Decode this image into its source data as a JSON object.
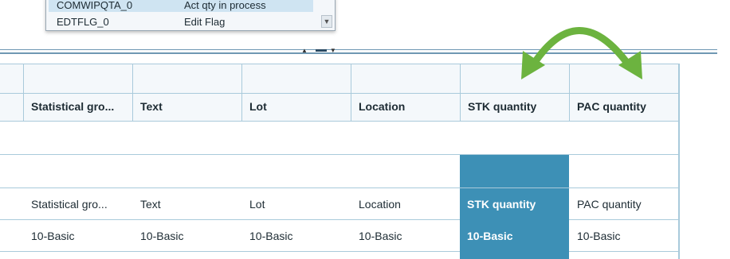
{
  "dropdown": {
    "items": [
      {
        "code": "COMWIPQTA_0",
        "label": "Act qty in process"
      },
      {
        "code": "EDTFLG_0",
        "label": "Edit Flag"
      }
    ]
  },
  "grid": {
    "headers": [
      "Statistical gro...",
      "Text",
      "Lot",
      "Location",
      "STK quantity",
      "PAC quantity"
    ],
    "label_row": [
      "Statistical gro...",
      "Text",
      "Lot",
      "Location",
      "STK quantity",
      "PAC quantity"
    ],
    "value_row": [
      "10-Basic",
      "10-Basic",
      "10-Basic",
      "10-Basic",
      "10-Basic",
      "10-Basic"
    ],
    "highlighted_column": "STK quantity"
  },
  "colors": {
    "highlight": "#3d90b6",
    "arrow": "#6cb33f",
    "grid_line": "#a9cadb"
  }
}
